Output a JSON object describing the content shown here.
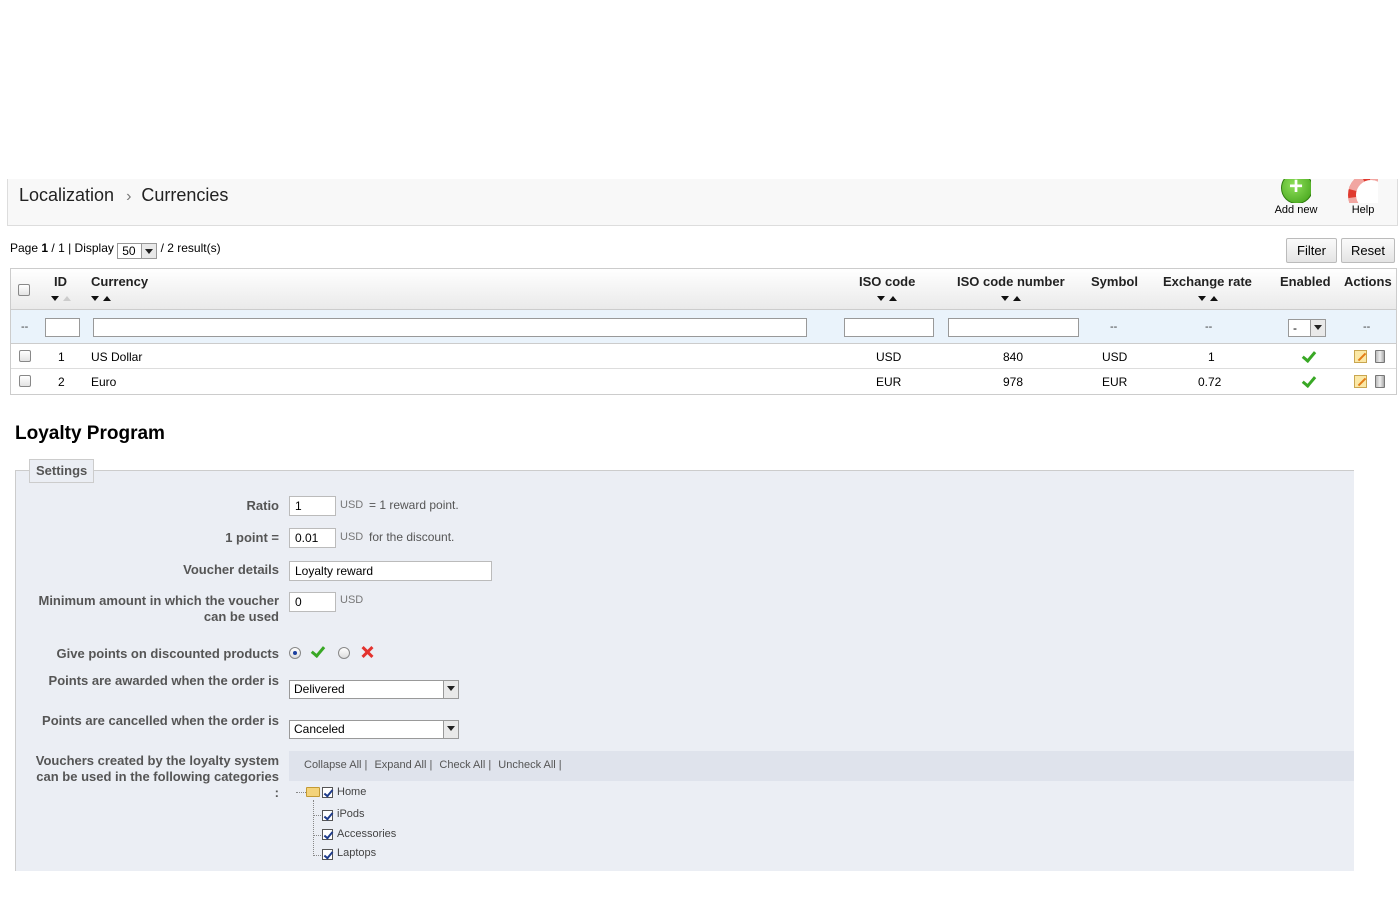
{
  "breadcrumb": {
    "parent": "Localization",
    "current": "Currencies"
  },
  "toolbar": {
    "add_label": "Add new",
    "help_label": "Help"
  },
  "pager": {
    "page_label": "Page",
    "page": "1",
    "of": "/ 1",
    "display_label": "| Display",
    "per_page": "50",
    "results": "/ 2 result(s)"
  },
  "buttons": {
    "filter": "Filter",
    "reset": "Reset"
  },
  "table": {
    "headers": {
      "id": "ID",
      "currency": "Currency",
      "iso": "ISO code",
      "iso_num": "ISO code number",
      "symbol": "Symbol",
      "rate": "Exchange rate",
      "enabled": "Enabled",
      "actions": "Actions"
    },
    "filter_dash": "--",
    "enabled_filter": "-",
    "rows": [
      {
        "id": "1",
        "currency": "US Dollar",
        "iso": "USD",
        "iso_num": "840",
        "symbol": "USD",
        "rate": "1"
      },
      {
        "id": "2",
        "currency": "Euro",
        "iso": "EUR",
        "iso_num": "978",
        "symbol": "EUR",
        "rate": "0.72"
      }
    ]
  },
  "loyalty": {
    "title": "Loyalty Program",
    "legend": "Settings",
    "ratio_label": "Ratio",
    "ratio_value": "1",
    "ratio_unit": "USD",
    "ratio_note": "= 1 reward point.",
    "point_label": "1 point =",
    "point_value": "0.01",
    "point_unit": "USD",
    "point_note": "for the discount.",
    "voucher_label": "Voucher details",
    "voucher_value": "Loyalty reward",
    "min_label_1": "Minimum amount in which the voucher",
    "min_label_2": "can be used",
    "min_value": "0",
    "min_unit": "USD",
    "give_label": "Give points on discounted products",
    "awarded_label": "Points are awarded when the order is",
    "awarded_value": "Delivered",
    "cancelled_label": "Points are cancelled when the order is",
    "cancelled_value": "Canceled",
    "cats_label_1": "Vouchers created by the loyalty system",
    "cats_label_2": "can be used in the following categories",
    "cats_label_3": ":",
    "tree_actions": [
      "Collapse All |",
      "Expand All |",
      "Check All |",
      "Uncheck All |"
    ],
    "tree": {
      "root": "Home",
      "children": [
        "iPods",
        "Accessories",
        "Laptops"
      ]
    }
  }
}
